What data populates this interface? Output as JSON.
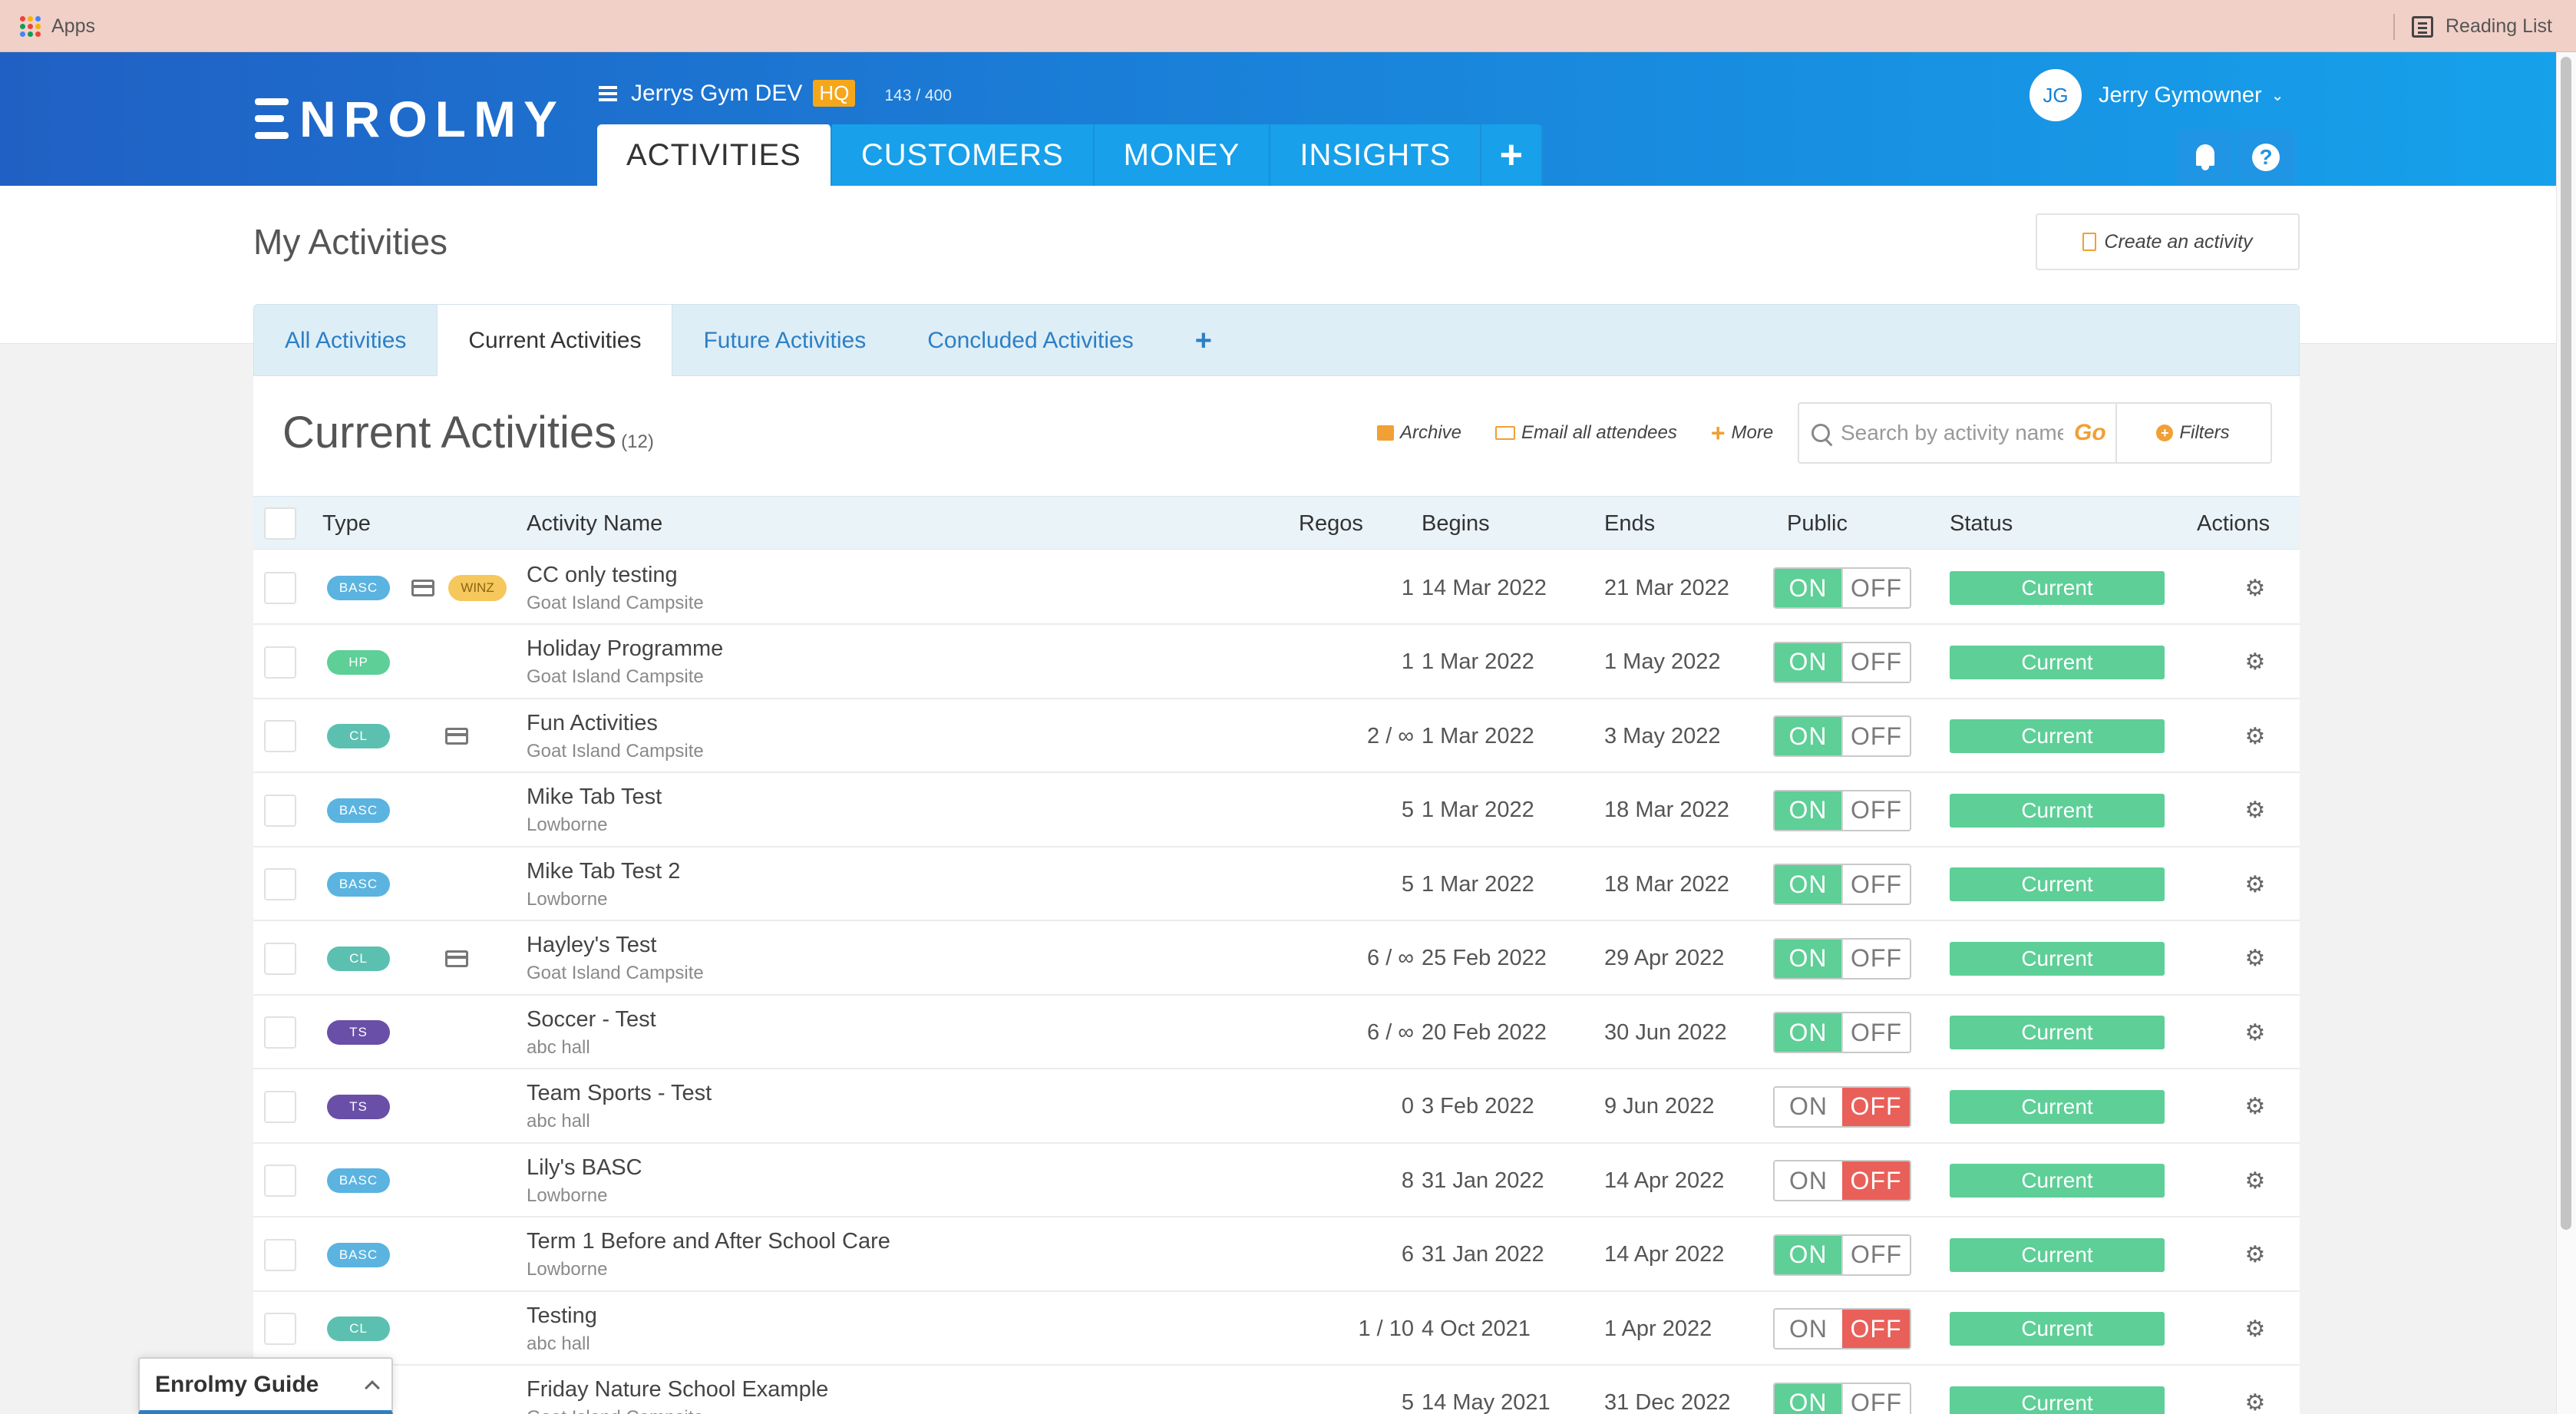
{
  "browser": {
    "apps_label": "Apps",
    "reading_list_label": "Reading List"
  },
  "header": {
    "logo_text": "NROLMY",
    "account_name": "Jerrys Gym DEV",
    "account_badge": "HQ",
    "usage_count": "143 / 400",
    "nav": [
      "ACTIVITIES",
      "CUSTOMERS",
      "MONEY",
      "INSIGHTS"
    ],
    "nav_plus": "+",
    "user_initials": "JG",
    "user_name": "Jerry Gymowner",
    "help_label": "?"
  },
  "page": {
    "title": "My Activities",
    "create_button": "Create an activity"
  },
  "subtabs": [
    "All Activities",
    "Current Activities",
    "Future Activities",
    "Concluded Activities"
  ],
  "subtab_plus": "+",
  "list": {
    "title": "Current Activities",
    "count": "(12)",
    "archive_label": "Archive",
    "email_label": "Email all attendees",
    "more_label": "More",
    "search_placeholder": "Search by activity name",
    "go_label": "Go",
    "filters_label": "Filters"
  },
  "columns": {
    "type": "Type",
    "name": "Activity Name",
    "regos": "Regos",
    "begins": "Begins",
    "ends": "Ends",
    "public": "Public",
    "status": "Status",
    "actions": "Actions"
  },
  "toggle_labels": {
    "on": "ON",
    "off": "OFF"
  },
  "type_colors": {
    "BASC": "#5bb3e0",
    "HP": "#5dcf97",
    "CL": "#5cc0b0",
    "TS": "#6a4fa8"
  },
  "rows": [
    {
      "type": "BASC",
      "card": true,
      "winz": "WINZ",
      "name": "CC only testing",
      "venue": "Goat Island Campsite",
      "regos": "1",
      "begins": "14 Mar 2022",
      "ends": "21 Mar 2022",
      "public": true,
      "status": "Current"
    },
    {
      "type": "HP",
      "card": false,
      "winz": "",
      "name": "Holiday Programme",
      "venue": "Goat Island Campsite",
      "regos": "1",
      "begins": "1 Mar 2022",
      "ends": "1 May 2022",
      "public": true,
      "status": "Current"
    },
    {
      "type": "CL",
      "card": true,
      "winz": "",
      "name": "Fun Activities",
      "venue": "Goat Island Campsite",
      "regos": "2 / ∞",
      "begins": "1 Mar 2022",
      "ends": "3 May 2022",
      "public": true,
      "status": "Current"
    },
    {
      "type": "BASC",
      "card": false,
      "winz": "",
      "name": "Mike Tab Test",
      "venue": "Lowborne",
      "regos": "5",
      "begins": "1 Mar 2022",
      "ends": "18 Mar 2022",
      "public": true,
      "status": "Current"
    },
    {
      "type": "BASC",
      "card": false,
      "winz": "",
      "name": "Mike Tab Test 2",
      "venue": "Lowborne",
      "regos": "5",
      "begins": "1 Mar 2022",
      "ends": "18 Mar 2022",
      "public": true,
      "status": "Current"
    },
    {
      "type": "CL",
      "card": true,
      "winz": "",
      "name": "Hayley's Test",
      "venue": "Goat Island Campsite",
      "regos": "6 / ∞",
      "begins": "25 Feb 2022",
      "ends": "29 Apr 2022",
      "public": true,
      "status": "Current"
    },
    {
      "type": "TS",
      "card": false,
      "winz": "",
      "name": "Soccer - Test",
      "venue": "abc hall",
      "regos": "6 / ∞",
      "begins": "20 Feb 2022",
      "ends": "30 Jun 2022",
      "public": true,
      "status": "Current"
    },
    {
      "type": "TS",
      "card": false,
      "winz": "",
      "name": "Team Sports - Test",
      "venue": "abc hall",
      "regos": "0",
      "begins": "3 Feb 2022",
      "ends": "9 Jun 2022",
      "public": false,
      "status": "Current"
    },
    {
      "type": "BASC",
      "card": false,
      "winz": "",
      "name": "Lily's BASC",
      "venue": "Lowborne",
      "regos": "8",
      "begins": "31 Jan 2022",
      "ends": "14 Apr 2022",
      "public": false,
      "status": "Current"
    },
    {
      "type": "BASC",
      "card": false,
      "winz": "",
      "name": "Term 1 Before and After School Care",
      "venue": "Lowborne",
      "regos": "6",
      "begins": "31 Jan 2022",
      "ends": "14 Apr 2022",
      "public": true,
      "status": "Current"
    },
    {
      "type": "CL",
      "card": false,
      "winz": "",
      "name": "Testing",
      "venue": "abc hall",
      "regos": "1 / 10",
      "begins": "4 Oct 2021",
      "ends": "1 Apr 2022",
      "public": false,
      "status": "Current"
    },
    {
      "type": "",
      "card": false,
      "winz": "",
      "name": "Friday Nature School Example",
      "venue": "Goat Island Campsite",
      "regos": "5",
      "begins": "14 May 2021",
      "ends": "31 Dec 2022",
      "public": true,
      "status": "Current"
    }
  ],
  "guide": {
    "title": "Enrolmy Guide"
  }
}
